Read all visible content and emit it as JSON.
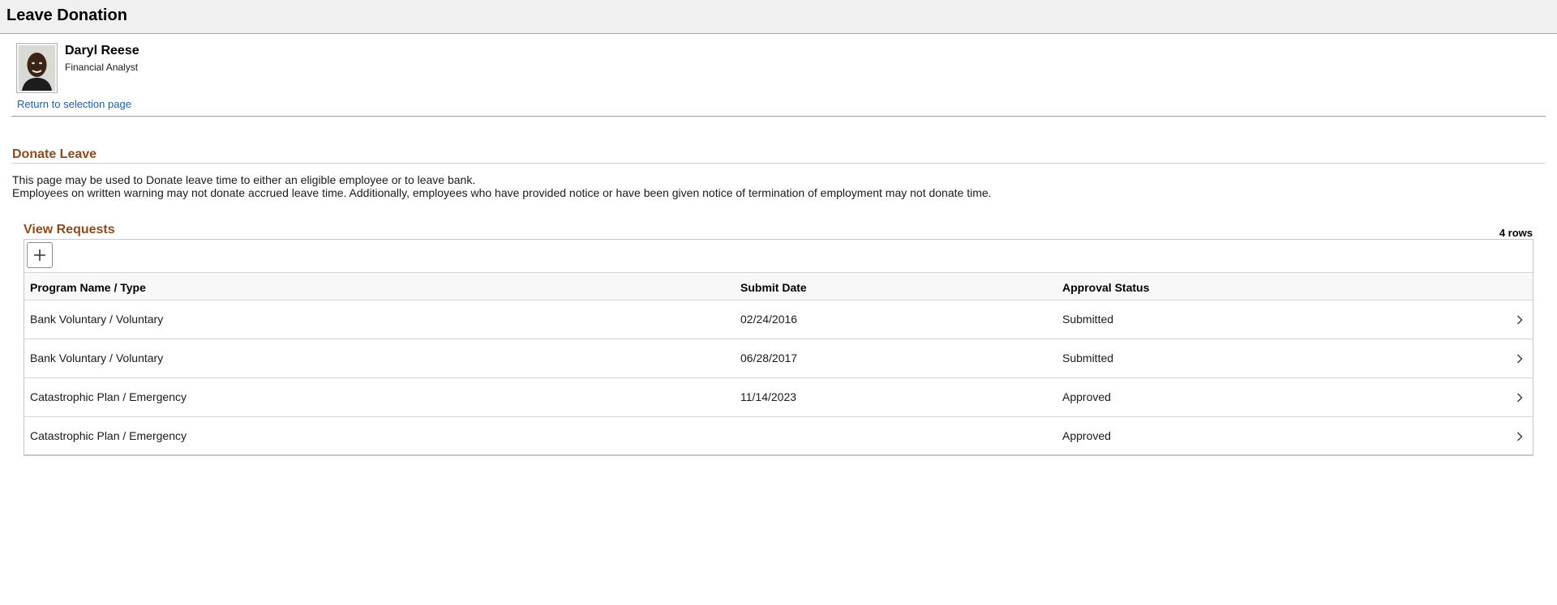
{
  "header": {
    "title": "Leave Donation"
  },
  "employee": {
    "name": "Daryl Reese",
    "title": "Financial Analyst",
    "return_link": "Return to selection page"
  },
  "section": {
    "title": "Donate Leave",
    "desc_line1": "This page may be used to Donate leave time to either an eligible employee or to leave bank.",
    "desc_line2": "Employees on written warning may not donate accrued leave time. Additionally, employees who have provided notice or have been given notice of termination of employment may not donate time."
  },
  "grid": {
    "title": "View Requests",
    "row_count": "4 rows",
    "add_icon": "plus-icon",
    "columns": [
      "Program Name / Type",
      "Submit Date",
      "Approval Status"
    ],
    "rows": [
      {
        "program": "Bank Voluntary / Voluntary",
        "date": "02/24/2016",
        "status": "Submitted"
      },
      {
        "program": "Bank Voluntary / Voluntary",
        "date": "06/28/2017",
        "status": "Submitted"
      },
      {
        "program": "Catastrophic Plan / Emergency",
        "date": "11/14/2023",
        "status": "Approved"
      },
      {
        "program": "Catastrophic Plan / Emergency",
        "date": "",
        "status": "Approved"
      }
    ],
    "row_icon": "chevron-right-icon"
  },
  "colors": {
    "section_title": "#8b4b1f",
    "link": "#1f5e9d",
    "header_bg": "#f0f0f0"
  }
}
